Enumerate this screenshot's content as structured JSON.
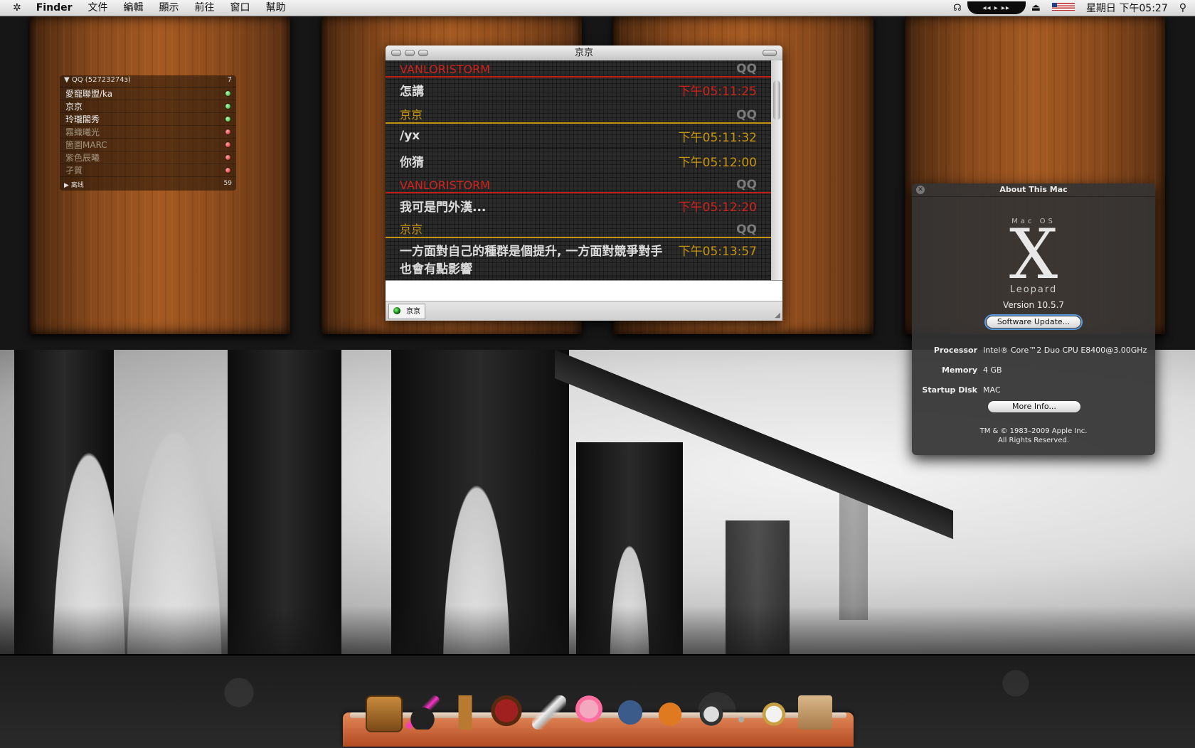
{
  "menubar": {
    "apple": "✲",
    "items": [
      "Finder",
      "文件",
      "編輯",
      "顯示",
      "前往",
      "窗口",
      "幫助"
    ],
    "media": "◂◂ ▸ ▸▸",
    "eject": "⏏",
    "clock": "星期日 下午05:27",
    "spotlight": "⚲"
  },
  "qq_widget": {
    "header": "QQ (52723274з)",
    "header_count": "7",
    "buddies": [
      {
        "name": "愛寵聯盟/ka",
        "online": true
      },
      {
        "name": "京京",
        "online": true
      },
      {
        "name": "玲瓏閣秀",
        "online": true
      },
      {
        "name": "霧織曦光",
        "online": false
      },
      {
        "name": "箇園MARC",
        "online": false
      },
      {
        "name": "紫色辰曦",
        "online": false
      },
      {
        "name": "孑質",
        "online": false
      }
    ],
    "footer_label": "离线",
    "footer_count": "59"
  },
  "chat": {
    "title": "京京",
    "qq_tag": "QQ",
    "blocks": [
      {
        "sender": "VANLORISTORM",
        "color": "red",
        "messages": [
          {
            "text": "怎講",
            "time": "下午05:11:25"
          }
        ]
      },
      {
        "sender": "京京",
        "color": "gold",
        "messages": [
          {
            "text": "/yx",
            "time": "下午05:11:32"
          },
          {
            "text": "你猜",
            "time": "下午05:12:00"
          }
        ]
      },
      {
        "sender": "VANLORISTORM",
        "color": "red",
        "messages": [
          {
            "text": "我可是門外漢...",
            "time": "下午05:12:20"
          }
        ]
      },
      {
        "sender": "京京",
        "color": "gold",
        "messages": [
          {
            "text": "一方面對自己的種群是個提升, 一方面對競爭對手也會有點影響",
            "time": "下午05:13:57"
          }
        ]
      }
    ],
    "tab_label": "京京"
  },
  "about": {
    "title": "About This Mac",
    "os_label": "Mac OS",
    "os_x": "X",
    "os_name": "Leopard",
    "version": "Version 10.5.7",
    "update_button": "Software Update...",
    "specs": [
      {
        "key": "Processor",
        "value": "Intel® Core™2 Duo CPU E8400@3.00GHz"
      },
      {
        "key": "Memory",
        "value": "4 GB"
      },
      {
        "key": "Startup Disk",
        "value": "MAC"
      }
    ],
    "more_button": "More Info...",
    "copyright_1": "TM & © 1983–2009 Apple Inc.",
    "copyright_2": "All Rights Reserved."
  },
  "dock": {
    "icons": [
      "bookshelf-icon",
      "magic-hat-icon",
      "easel-icon",
      "armchair-icon",
      "quill-icon",
      "chopper-icon",
      "robot-icon",
      "firefox-icon",
      "penguin-icon",
      "separator",
      "bird-icon",
      "trash-icon"
    ]
  },
  "colors": {
    "accent_red": "#d2231b",
    "accent_gold": "#c6950c",
    "focus_blue": "#5b9be0"
  }
}
